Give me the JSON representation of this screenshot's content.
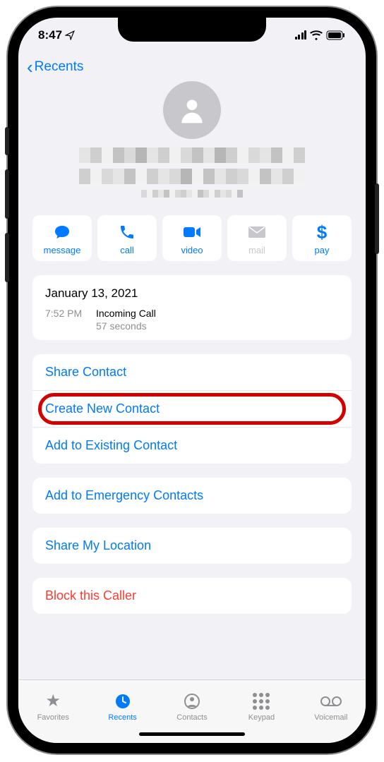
{
  "status": {
    "time": "8:47"
  },
  "nav": {
    "back_label": "Recents"
  },
  "actions": {
    "message": "message",
    "call": "call",
    "video": "video",
    "mail": "mail",
    "pay": "pay"
  },
  "call_log": {
    "date": "January 13, 2021",
    "time": "7:52 PM",
    "type": "Incoming Call",
    "duration": "57 seconds"
  },
  "options": {
    "share_contact": "Share Contact",
    "create_new": "Create New Contact",
    "add_existing": "Add to Existing Contact",
    "add_emergency": "Add to Emergency Contacts",
    "share_location": "Share My Location",
    "block": "Block this Caller"
  },
  "tabs": {
    "favorites": "Favorites",
    "recents": "Recents",
    "contacts": "Contacts",
    "keypad": "Keypad",
    "voicemail": "Voicemail"
  }
}
